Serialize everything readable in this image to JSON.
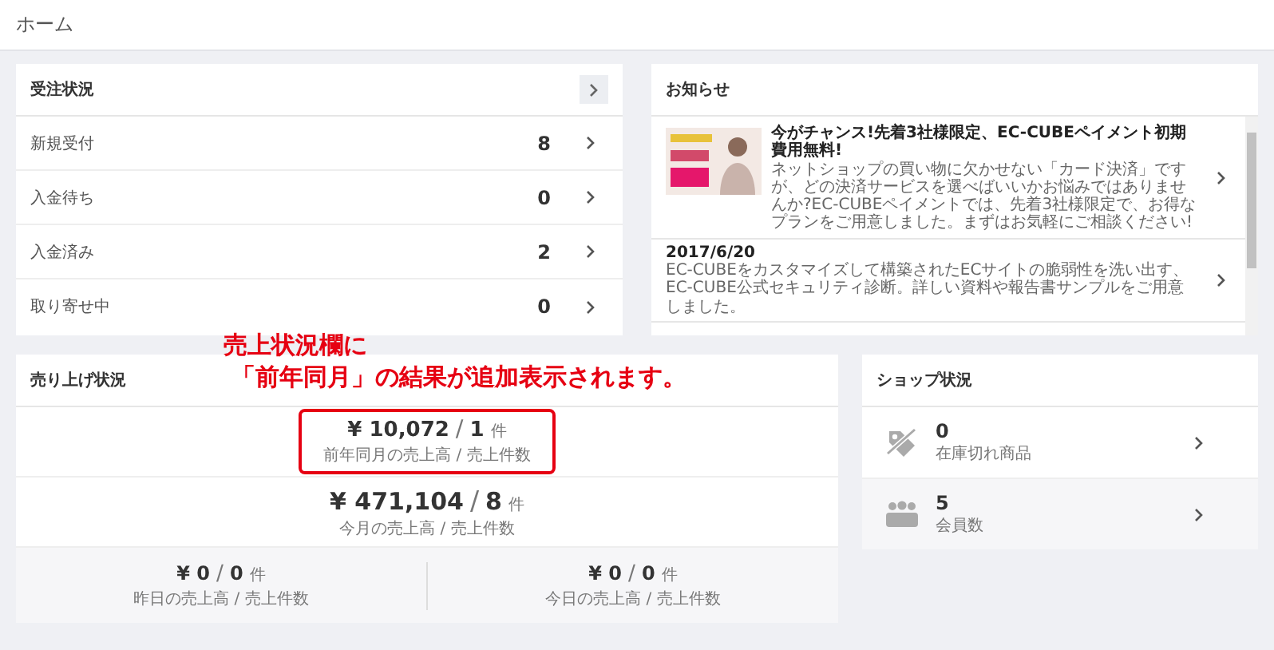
{
  "breadcrumb": "ホーム",
  "orders": {
    "title": "受注状況",
    "rows": [
      {
        "label": "新規受付",
        "count": "8"
      },
      {
        "label": "入金待ち",
        "count": "0"
      },
      {
        "label": "入金済み",
        "count": "2"
      },
      {
        "label": "取り寄せ中",
        "count": "0"
      }
    ]
  },
  "news": {
    "title": "お知らせ",
    "items": [
      {
        "kind": "banner",
        "title": "今がチャンス!先着3社様限定、EC-CUBEペイメント初期費用無料!",
        "body": "ネットショップの買い物に欠かせない「カード決済」ですが、どの決済サービスを選べばいいかお悩みではありませんか?EC-CUBEペイメントでは、先着3社様限定で、お得なプランをご用意しました。まずはお気軽にご相談ください!"
      },
      {
        "kind": "text",
        "date": "2017/6/20",
        "body": "EC-CUBEをカスタマイズして構築されたECサイトの脆弱性を洗い出す、EC-CUBE公式セキュリティ診断。詳しい資料や報告書サンプルをご用意しました。"
      }
    ]
  },
  "annotation": [
    "売上状況欄に",
    "「前年同月」の結果が追加表示されます。"
  ],
  "sales": {
    "title": "売り上げ状況",
    "rows": [
      {
        "amount": "¥ 10,072",
        "sep": "/",
        "count": "1",
        "unit": "件",
        "caption": "前年同月の売上高 / 売上件数",
        "highlighted": true
      },
      {
        "amount": "¥ 471,104",
        "sep": "/",
        "count": "8",
        "unit": "件",
        "caption": "今月の売上高 / 売上件数",
        "highlighted": false
      }
    ],
    "daily": [
      {
        "amount": "¥ 0",
        "sep": "/",
        "count": "0",
        "unit": "件",
        "caption": "昨日の売上高 / 売上件数"
      },
      {
        "amount": "¥ 0",
        "sep": "/",
        "count": "0",
        "unit": "件",
        "caption": "今日の売上高 / 売上件数"
      }
    ]
  },
  "shop": {
    "title": "ショップ状況",
    "items": [
      {
        "kind": "stock",
        "value": "0",
        "caption": "在庫切れ商品"
      },
      {
        "kind": "members",
        "value": "5",
        "caption": "会員数"
      }
    ]
  }
}
